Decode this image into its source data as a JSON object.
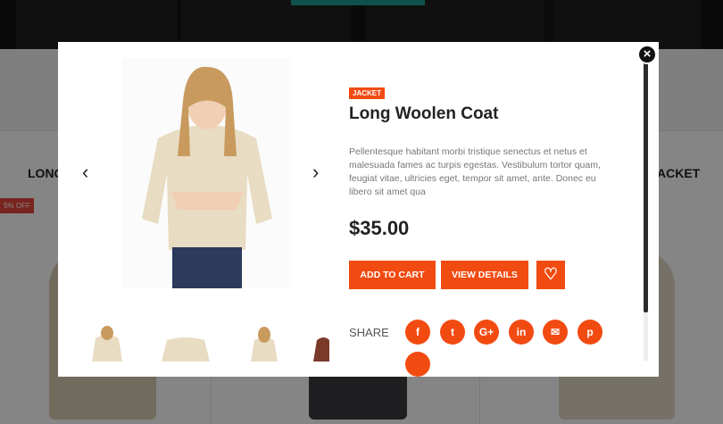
{
  "background": {
    "left_label": "LONG",
    "right_label": "ACKET",
    "sale_badge": "5% OFF"
  },
  "modal": {
    "close_icon": "×",
    "prev_icon": "‹",
    "next_icon": "›",
    "category": "JACKET",
    "title": "Long Woolen Coat",
    "description": "Pellentesque habitant morbi tristique senectus et netus et malesuada fames ac turpis egestas. Vestibulum tortor quam, feugiat vitae, ultricies eget, tempor sit amet, ante. Donec eu libero sit amet qua",
    "price": "$35.00",
    "add_to_cart": "ADD TO CART",
    "view_details": "VIEW DETAILS",
    "wishlist_icon": "♡",
    "share_label": "SHARE",
    "social": [
      "f",
      "t",
      "G+",
      "in",
      "✉",
      "p"
    ]
  },
  "colors": {
    "accent": "#f24b12",
    "dark": "#222222",
    "sale": "#e8453c",
    "teal": "#1e9e92"
  }
}
